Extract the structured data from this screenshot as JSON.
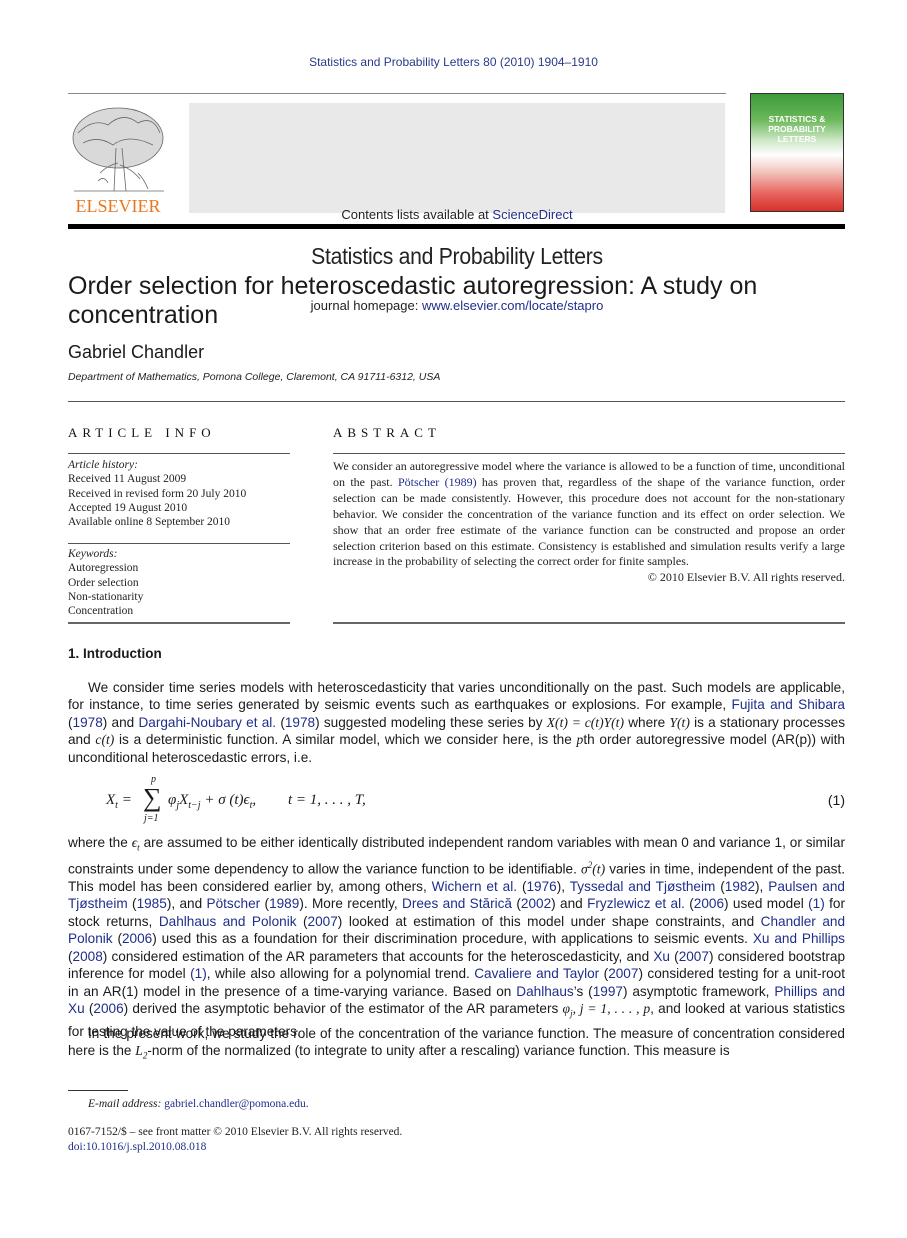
{
  "running_header": "Statistics and Probability Letters 80 (2010) 1904–1910",
  "banner": {
    "contents_prefix": "Contents lists available at ",
    "contents_link": "ScienceDirect",
    "journal_title": "Statistics and Probability Letters",
    "homepage_prefix": "journal homepage: ",
    "homepage_link": "www.elsevier.com/locate/stapro",
    "publisher_logo_text": "ELSEVIER",
    "cover_title_lines": [
      "STATISTICS &",
      "PROBABILITY",
      "LETTERS"
    ]
  },
  "article": {
    "title": "Order selection for heteroscedastic autoregression: A study on concentration",
    "author": "Gabriel Chandler",
    "affiliation": "Department of Mathematics, Pomona College, Claremont, CA 91711-6312, USA"
  },
  "article_info": {
    "heading": "ARTICLE INFO",
    "history_label": "Article history:",
    "history": [
      "Received 11 August 2009",
      "Received in revised form 20 July 2010",
      "Accepted 19 August 2010",
      "Available online 8 September 2010"
    ],
    "keywords_label": "Keywords:",
    "keywords": [
      "Autoregression",
      "Order selection",
      "Non-stationarity",
      "Concentration"
    ]
  },
  "abstract": {
    "heading": "ABSTRACT",
    "text_1": "We consider an autoregressive model where the variance is allowed to be a function of time, unconditional on the past. ",
    "link_1": "Pötscher (1989)",
    "text_2": " has proven that, regardless of the shape of the variance function, order selection can be made consistently. However, this procedure does not account for the non-stationary behavior. We consider the concentration of the variance function and its effect on order selection. We show that an order free estimate of the variance function can be constructed and propose an order selection criterion based on this estimate. Consistency is established and simulation results verify a large increase in the probability of selecting the correct order for finite samples.",
    "copyright": "© 2010 Elsevier B.V. All rights reserved."
  },
  "section": {
    "heading": "1.  Introduction",
    "p1": [
      {
        "t": "We consider time series models with heteroscedasticity that varies unconditionally on the past. Such models are applicable, for instance, to time series generated by seismic events such as earthquakes or explosions. For example, "
      },
      {
        "l": "Fujita and Shibara"
      },
      {
        "t": " ("
      },
      {
        "l": "1978"
      },
      {
        "t": ") and "
      },
      {
        "l": "Dargahi-Noubary et al."
      },
      {
        "t": " ("
      },
      {
        "l": "1978"
      },
      {
        "t": ") suggested modeling these series by "
      },
      {
        "m": "X(t) = c(t)Y(t)"
      },
      {
        "t": " where "
      },
      {
        "m": "Y(t)"
      },
      {
        "t": " is a stationary processes and "
      },
      {
        "m": "c(t)"
      },
      {
        "t": " is a deterministic function. A similar model, which we consider here, is the "
      },
      {
        "m": "p"
      },
      {
        "t": "th order autoregressive model (AR(p)) with unconditional heteroscedastic errors, i.e."
      }
    ],
    "equation": {
      "lhs": "X",
      "lhs_sub": "t",
      "sum_upper": "p",
      "sum_lower": "j=1",
      "rhs": "φ_j X_{t−j} + σ(t)ϵ_t,",
      "range": "t = 1, . . . , T,",
      "number": "(1)"
    },
    "p2": [
      {
        "t": "where the "
      },
      {
        "m": "ϵ"
      },
      {
        "sub": "t"
      },
      {
        "t": " are assumed to be either identically distributed independent random variables with mean 0 and variance 1, or similar constraints under some dependency to allow the variance function to be identifiable. "
      },
      {
        "m": "σ"
      },
      {
        "sup": "2"
      },
      {
        "m": "(t)"
      },
      {
        "t": " varies in time, independent of the past. This model has been considered earlier by, among others, "
      },
      {
        "l": "Wichern et al."
      },
      {
        "t": " ("
      },
      {
        "l": "1976"
      },
      {
        "t": "), "
      },
      {
        "l": "Tyssedal and Tjøstheim"
      },
      {
        "t": " ("
      },
      {
        "l": "1982"
      },
      {
        "t": "), "
      },
      {
        "l": "Paulsen and Tjøstheim"
      },
      {
        "t": " ("
      },
      {
        "l": "1985"
      },
      {
        "t": "), and "
      },
      {
        "l": "Pötscher"
      },
      {
        "t": " ("
      },
      {
        "l": "1989"
      },
      {
        "t": "). More recently, "
      },
      {
        "l": "Drees and Stărică"
      },
      {
        "t": " ("
      },
      {
        "l": "2002"
      },
      {
        "t": ") and "
      },
      {
        "l": "Fryzlewicz et al."
      },
      {
        "t": " ("
      },
      {
        "l": "2006"
      },
      {
        "t": ") used model "
      },
      {
        "l": "(1)"
      },
      {
        "t": " for stock returns, "
      },
      {
        "l": "Dahlhaus and Polonik"
      },
      {
        "t": " ("
      },
      {
        "l": "2007"
      },
      {
        "t": ") looked at estimation of this model under shape constraints, and "
      },
      {
        "l": "Chandler and Polonik"
      },
      {
        "t": " ("
      },
      {
        "l": "2006"
      },
      {
        "t": ") used this as a foundation for their discrimination procedure, with applications to seismic events. "
      },
      {
        "l": "Xu and Phillips"
      },
      {
        "t": " ("
      },
      {
        "l": "2008"
      },
      {
        "t": ") considered estimation of the AR parameters that accounts for the heteroscedasticity, and "
      },
      {
        "l": "Xu"
      },
      {
        "t": " ("
      },
      {
        "l": "2007"
      },
      {
        "t": ") considered bootstrap inference for model "
      },
      {
        "l": "(1)"
      },
      {
        "t": ", while also allowing for a polynomial trend. "
      },
      {
        "l": "Cavaliere and Taylor"
      },
      {
        "t": " ("
      },
      {
        "l": "2007"
      },
      {
        "t": ") considered testing for a unit-root in an AR(1) model in the presence of a time-varying variance. Based on "
      },
      {
        "l": "Dahlhaus"
      },
      {
        "t": "’s ("
      },
      {
        "l": "1997"
      },
      {
        "t": ") asymptotic framework, "
      },
      {
        "l": "Phillips and Xu"
      },
      {
        "t": " ("
      },
      {
        "l": "2006"
      },
      {
        "t": ") derived the asymptotic behavior of the estimator of the AR parameters "
      },
      {
        "m": "φ"
      },
      {
        "sub": "j"
      },
      {
        "m": ", j = 1, . . . , p"
      },
      {
        "t": ", and looked at various statistics for testing the value of the parameters."
      }
    ],
    "p3": [
      {
        "t": "In the present work, we study the role of the concentration of the variance function. The measure of concentration considered here is the "
      },
      {
        "m": "L"
      },
      {
        "sub": "2"
      },
      {
        "t": "-norm of the normalized (to integrate to unity after a rescaling) variance function. This measure is"
      }
    ]
  },
  "footnote": {
    "email_label": "E-mail address: ",
    "email": "gabriel.chandler@pomona.edu",
    "email_suffix": ".",
    "issn_line": "0167-7152/$ – see front matter © 2010 Elsevier B.V. All rights reserved.",
    "doi": "doi:10.1016/j.spl.2010.08.018"
  }
}
